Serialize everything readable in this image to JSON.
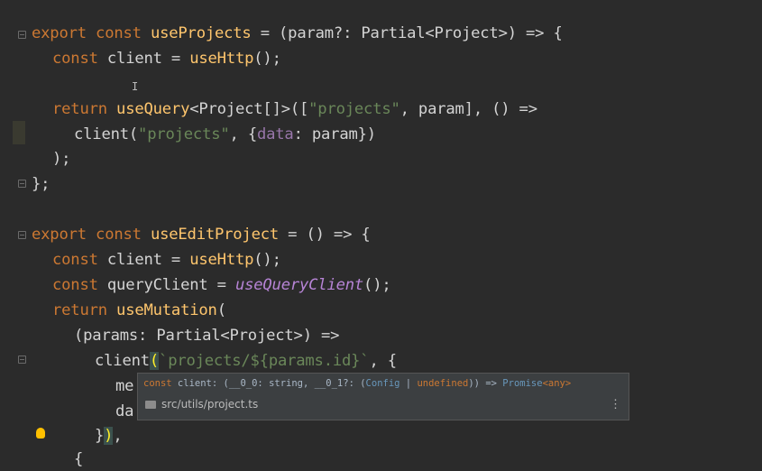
{
  "code": {
    "l1": [
      "export",
      "const",
      "useProjects",
      " = (param?: Partial<Project>) => {"
    ],
    "l2": [
      "const",
      " client = ",
      "useHttp",
      "();"
    ],
    "l3": [
      "return",
      "useQuery",
      "<Project[]>([",
      "\"projects\"",
      ", param], () =>"
    ],
    "l4": [
      "client(",
      "\"projects\"",
      ", {",
      "data",
      ": param})"
    ],
    "l5": ");",
    "l6": "};",
    "l7": [
      "export",
      "const",
      "useEditProject",
      " = () => {"
    ],
    "l8": [
      "const",
      " client = ",
      "useHttp",
      "();"
    ],
    "l9": [
      "const",
      " queryClient = ",
      "useQueryClient",
      "();"
    ],
    "l10": [
      "return",
      "useMutation",
      "("
    ],
    "l11": "(params: Partial<Project>) =>",
    "l12": [
      "client",
      "(",
      "`projects/${params.id}`",
      ", {"
    ],
    "l13": "me",
    "l14": "da",
    "l15": [
      "}",
      ")",
      ","
    ],
    "l16": "{"
  },
  "popup": {
    "sig_prefix": "const",
    "sig_name": " client: (__0_0: string, __0_1?: (",
    "sig_config": "Config",
    "sig_sep": " | ",
    "sig_undef": "undefined",
    "sig_mid": ")) => ",
    "sig_promise": "Promise",
    "sig_any": "<any>",
    "location": "src/utils/project.ts",
    "more": "⋮"
  },
  "editor": {
    "cursor": "I"
  }
}
